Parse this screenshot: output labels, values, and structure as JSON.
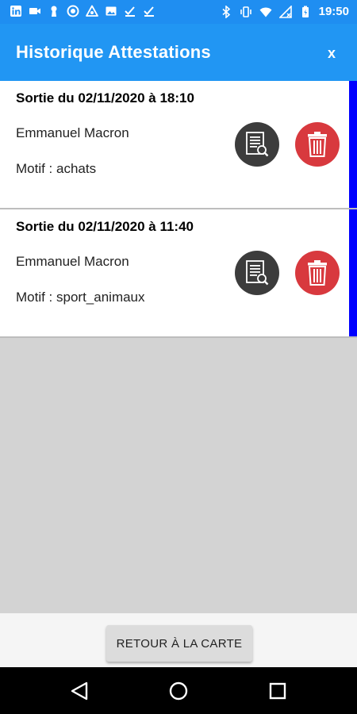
{
  "status_bar": {
    "time": "19:50",
    "left_icons": [
      "linkedin-icon",
      "video-icon",
      "keyhole-icon",
      "circle-icon",
      "warning-icon",
      "image-icon",
      "check-icon",
      "check-icon"
    ],
    "right_icons": [
      "bluetooth-icon",
      "vibrate-icon",
      "wifi-icon",
      "no-signal-icon",
      "battery-charging-icon"
    ]
  },
  "header": {
    "title": "Historique Attestations",
    "close_label": "x"
  },
  "attestations": [
    {
      "title": "Sortie du 02/11/2020 à 18:10",
      "name": "Emmanuel Macron",
      "motif": "Motif : achats"
    },
    {
      "title": "Sortie du 02/11/2020 à 11:40",
      "name": "Emmanuel Macron",
      "motif": "Motif : sport_animaux"
    }
  ],
  "footer": {
    "return_button": "RETOUR À LA CARTE"
  },
  "colors": {
    "primary": "#2196f3",
    "status_bar": "#1f8ef1",
    "card_accent": "#0000ff",
    "view_button": "#3c3c3c",
    "delete_button": "#d8393e",
    "background": "#d3d3d3"
  }
}
